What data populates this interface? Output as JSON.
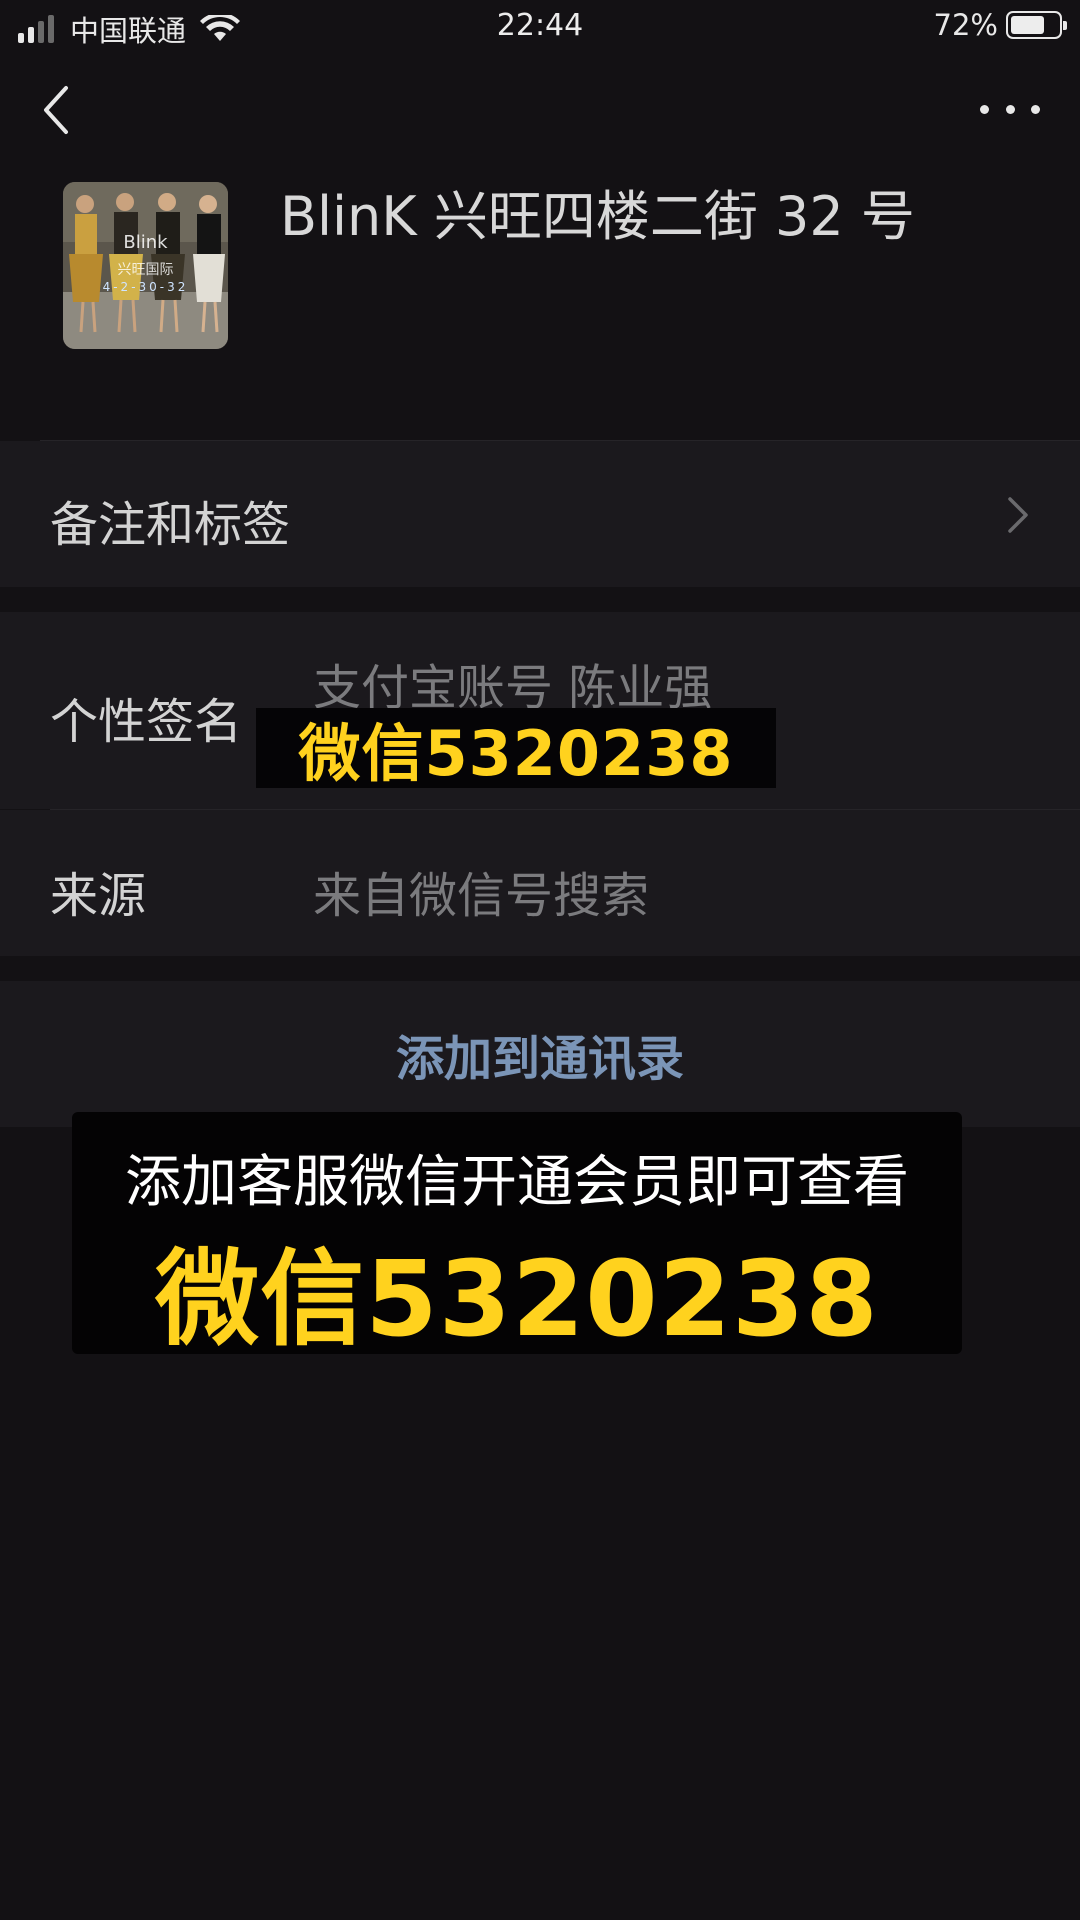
{
  "status_bar": {
    "carrier": "中国联通",
    "time": "22:44",
    "battery_percent_text": "72%",
    "battery_level": 0.72,
    "signal_bars_active": 2,
    "signal_bars_total": 4
  },
  "nav": {
    "back_icon": "chevron-left-icon",
    "more_icon": "more-horizontal-icon"
  },
  "profile": {
    "name": "BlinK 兴旺四楼二街 32 号",
    "avatar_text_1": "Blink",
    "avatar_text_2": "兴旺国际",
    "avatar_text_3": "4-2-30-32"
  },
  "rows": {
    "remarks_label": "备注和标签",
    "signature_label": "个性签名",
    "signature_value": "支付宝账号 陈业强",
    "source_label": "来源",
    "source_value": "来自微信号搜索"
  },
  "actions": {
    "add_contact_label": "添加到通讯录"
  },
  "overlays": {
    "small_text": "微信5320238",
    "big_line1": "添加客服微信开通会员即可查看",
    "big_line2": "微信5320238"
  },
  "colors": {
    "background": "#131114",
    "row_background": "#1b191d",
    "link_blue": "#7b95b7",
    "overlay_yellow": "#ffd21e"
  }
}
